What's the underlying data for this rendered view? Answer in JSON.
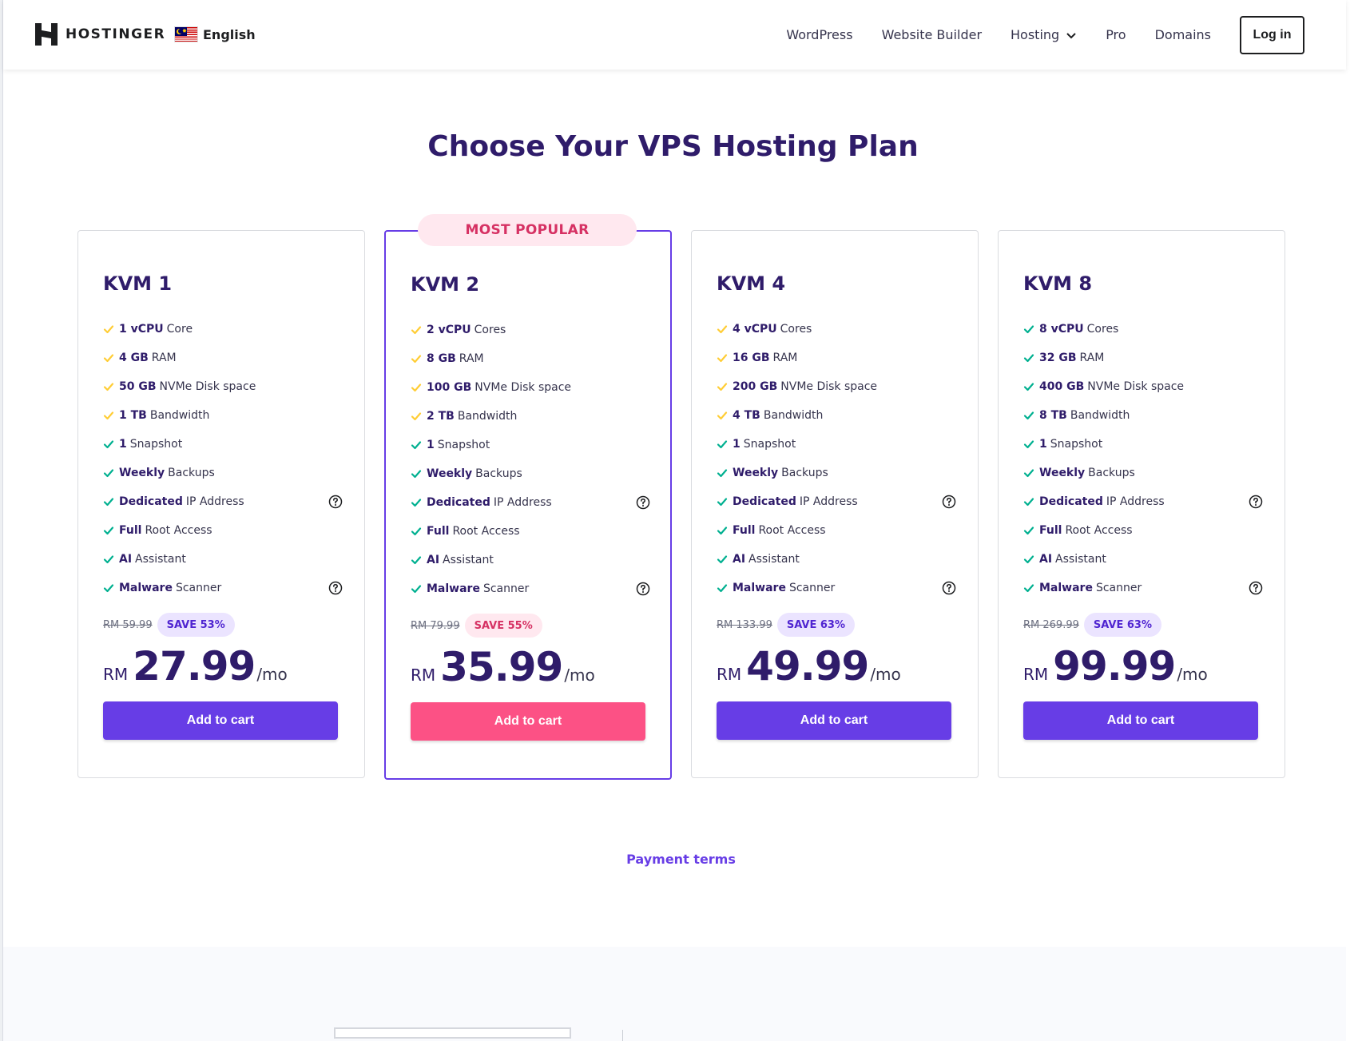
{
  "header": {
    "brand": "HOSTINGER",
    "language": "English",
    "nav": [
      {
        "label": "WordPress",
        "has_dropdown": false
      },
      {
        "label": "Website Builder",
        "has_dropdown": false
      },
      {
        "label": "Hosting",
        "has_dropdown": true
      },
      {
        "label": "Pro",
        "has_dropdown": false
      },
      {
        "label": "Domains",
        "has_dropdown": false
      }
    ],
    "login_label": "Log in"
  },
  "title": "Choose Your VPS Hosting Plan",
  "colors": {
    "primary": "#673de6",
    "pink": "#fc5185",
    "heading": "#2f1c6a",
    "check_yellow": "#ffcd35",
    "check_green": "#00b090"
  },
  "plans": [
    {
      "name": "KVM 1",
      "popular": false,
      "features": [
        {
          "bold": "1 vCPU",
          "text": "Core",
          "check": "yellow",
          "help": false
        },
        {
          "bold": "4 GB",
          "text": "RAM",
          "check": "yellow",
          "help": false
        },
        {
          "bold": "50 GB",
          "text": "NVMe Disk space",
          "check": "yellow",
          "help": false
        },
        {
          "bold": "1 TB",
          "text": "Bandwidth",
          "check": "yellow",
          "help": false
        },
        {
          "bold": "1",
          "text": "Snapshot",
          "check": "green",
          "help": false
        },
        {
          "bold": "Weekly",
          "text": "Backups",
          "check": "green",
          "help": false
        },
        {
          "bold": "Dedicated",
          "text": "IP Address",
          "check": "green",
          "help": true
        },
        {
          "bold": "Full",
          "text": "Root Access",
          "check": "green",
          "help": false
        },
        {
          "bold": "AI",
          "text": "Assistant",
          "check": "green",
          "help": false
        },
        {
          "bold": "Malware",
          "text": "Scanner",
          "check": "green",
          "help": true
        }
      ],
      "old_price": "RM 59.99",
      "save": "SAVE 53%",
      "currency": "RM",
      "price": "27.99",
      "period": "/mo",
      "cta": "Add to cart"
    },
    {
      "name": "KVM 2",
      "popular": true,
      "popular_label": "MOST POPULAR",
      "features": [
        {
          "bold": "2 vCPU",
          "text": "Cores",
          "check": "yellow",
          "help": false
        },
        {
          "bold": "8 GB",
          "text": "RAM",
          "check": "yellow",
          "help": false
        },
        {
          "bold": "100 GB",
          "text": "NVMe Disk space",
          "check": "yellow",
          "help": false
        },
        {
          "bold": "2 TB",
          "text": "Bandwidth",
          "check": "yellow",
          "help": false
        },
        {
          "bold": "1",
          "text": "Snapshot",
          "check": "green",
          "help": false
        },
        {
          "bold": "Weekly",
          "text": "Backups",
          "check": "green",
          "help": false
        },
        {
          "bold": "Dedicated",
          "text": "IP Address",
          "check": "green",
          "help": true
        },
        {
          "bold": "Full",
          "text": "Root Access",
          "check": "green",
          "help": false
        },
        {
          "bold": "AI",
          "text": "Assistant",
          "check": "green",
          "help": false
        },
        {
          "bold": "Malware",
          "text": "Scanner",
          "check": "green",
          "help": true
        }
      ],
      "old_price": "RM 79.99",
      "save": "SAVE 55%",
      "currency": "RM",
      "price": "35.99",
      "period": "/mo",
      "cta": "Add to cart"
    },
    {
      "name": "KVM 4",
      "popular": false,
      "features": [
        {
          "bold": "4 vCPU",
          "text": "Cores",
          "check": "yellow",
          "help": false
        },
        {
          "bold": "16 GB",
          "text": "RAM",
          "check": "yellow",
          "help": false
        },
        {
          "bold": "200 GB",
          "text": "NVMe Disk space",
          "check": "yellow",
          "help": false
        },
        {
          "bold": "4 TB",
          "text": "Bandwidth",
          "check": "yellow",
          "help": false
        },
        {
          "bold": "1",
          "text": "Snapshot",
          "check": "green",
          "help": false
        },
        {
          "bold": "Weekly",
          "text": "Backups",
          "check": "green",
          "help": false
        },
        {
          "bold": "Dedicated",
          "text": "IP Address",
          "check": "green",
          "help": true
        },
        {
          "bold": "Full",
          "text": "Root Access",
          "check": "green",
          "help": false
        },
        {
          "bold": "AI",
          "text": "Assistant",
          "check": "green",
          "help": false
        },
        {
          "bold": "Malware",
          "text": "Scanner",
          "check": "green",
          "help": true
        }
      ],
      "old_price": "RM 133.99",
      "save": "SAVE 63%",
      "currency": "RM",
      "price": "49.99",
      "period": "/mo",
      "cta": "Add to cart"
    },
    {
      "name": "KVM 8",
      "popular": false,
      "features": [
        {
          "bold": "8 vCPU",
          "text": "Cores",
          "check": "green",
          "help": false
        },
        {
          "bold": "32 GB",
          "text": "RAM",
          "check": "green",
          "help": false
        },
        {
          "bold": "400 GB",
          "text": "NVMe Disk space",
          "check": "green",
          "help": false
        },
        {
          "bold": "8 TB",
          "text": "Bandwidth",
          "check": "green",
          "help": false
        },
        {
          "bold": "1",
          "text": "Snapshot",
          "check": "green",
          "help": false
        },
        {
          "bold": "Weekly",
          "text": "Backups",
          "check": "green",
          "help": false
        },
        {
          "bold": "Dedicated",
          "text": "IP Address",
          "check": "green",
          "help": true
        },
        {
          "bold": "Full",
          "text": "Root Access",
          "check": "green",
          "help": false
        },
        {
          "bold": "AI",
          "text": "Assistant",
          "check": "green",
          "help": false
        },
        {
          "bold": "Malware",
          "text": "Scanner",
          "check": "green",
          "help": true
        }
      ],
      "old_price": "RM 269.99",
      "save": "SAVE 63%",
      "currency": "RM",
      "price": "99.99",
      "period": "/mo",
      "cta": "Add to cart"
    }
  ],
  "payment_terms": "Payment terms"
}
